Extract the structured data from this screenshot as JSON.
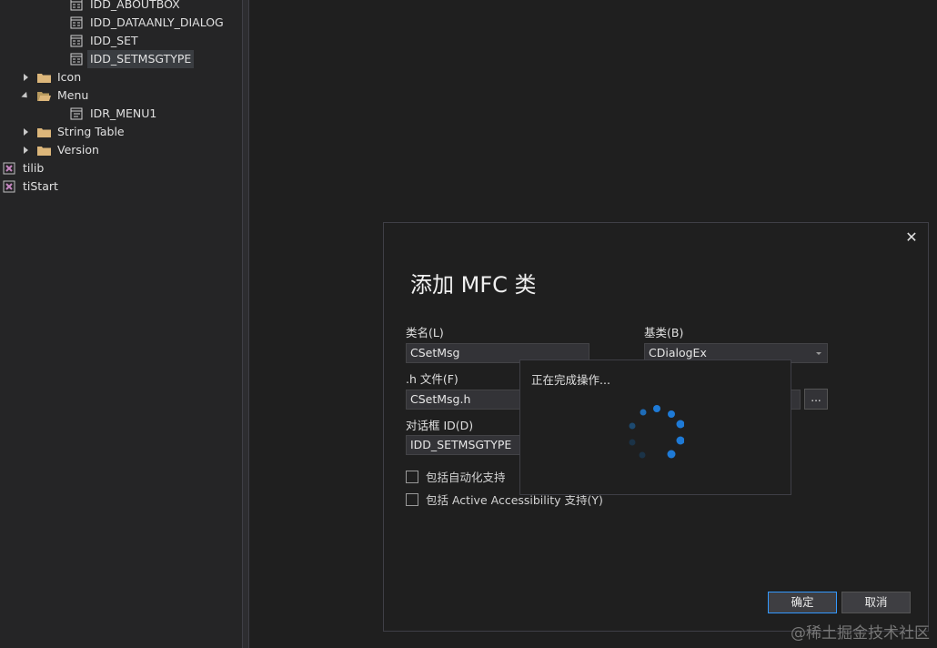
{
  "tree": {
    "items": [
      {
        "label": "IDD_ABOUTBOX",
        "icon": "dialog-resource-icon"
      },
      {
        "label": "IDD_DATAANLY_DIALOG",
        "icon": "dialog-resource-icon"
      },
      {
        "label": "IDD_SET",
        "icon": "dialog-resource-icon"
      },
      {
        "label": "IDD_SETMSGTYPE",
        "icon": "dialog-resource-icon",
        "selected": true
      },
      {
        "label": "Icon",
        "icon": "folder-icon",
        "expander": "collapsed"
      },
      {
        "label": "Menu",
        "icon": "folder-open-icon",
        "expander": "expanded"
      },
      {
        "label": "IDR_MENU1",
        "icon": "menu-resource-icon"
      },
      {
        "label": "String Table",
        "icon": "folder-icon",
        "expander": "collapsed"
      },
      {
        "label": "Version",
        "icon": "folder-icon",
        "expander": "collapsed"
      },
      {
        "label": "tilib",
        "icon": "project-icon",
        "expander": "collapsed"
      },
      {
        "label": "tiStart",
        "icon": "project-icon",
        "expander": "collapsed"
      }
    ]
  },
  "dialog": {
    "title": "添加 MFC 类",
    "close": "✕",
    "class_name_label": "类名(L)",
    "class_name_value": "CSetMsg",
    "base_class_label": "基类(B)",
    "base_class_value": "CDialogEx",
    "h_file_label": ".h 文件(F)",
    "h_file_value": "CSetMsg.h",
    "browse_label": "...",
    "dialog_id_label": "对话框 ID(D)",
    "dialog_id_value": "IDD_SETMSGTYPE",
    "checkbox_automation": "包括自动化支持",
    "checkbox_accessibility": "包括 Active Accessibility 支持(Y)",
    "ok_label": "确定",
    "cancel_label": "取消"
  },
  "progress": {
    "text": "正在完成操作..."
  },
  "watermark": "@稀土掘金技术社区",
  "colors": {
    "accent": "#3399ff",
    "folder": "#dcb67a",
    "spinner": "#1e7ad6"
  }
}
